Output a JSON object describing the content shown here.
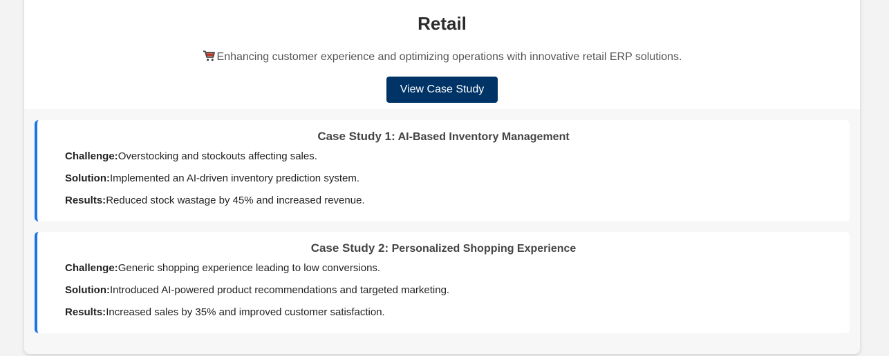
{
  "header": {
    "title": "Retail",
    "subtitle": "Enhancing customer experience and optimizing operations with innovative retail ERP solutions.",
    "subtitle_icon": "shopping-cart-icon",
    "button_label": "View Case Study"
  },
  "colors": {
    "button_bg": "#003366",
    "accent_border": "#1a73e8"
  },
  "case_studies": [
    {
      "label": "Case Study 1:",
      "title": "AI-Based Inventory Management",
      "challenge_label": "Challenge:",
      "challenge": "Overstocking and stockouts affecting sales.",
      "solution_label": "Solution:",
      "solution": "Implemented an AI-driven inventory prediction system.",
      "results_label": "Results:",
      "results": "Reduced stock wastage by 45% and increased revenue."
    },
    {
      "label": "Case Study 2:",
      "title": "Personalized Shopping Experience",
      "challenge_label": "Challenge:",
      "challenge": "Generic shopping experience leading to low conversions.",
      "solution_label": "Solution:",
      "solution": "Introduced AI-powered product recommendations and targeted marketing.",
      "results_label": "Results:",
      "results": "Increased sales by 35% and improved customer satisfaction."
    }
  ]
}
